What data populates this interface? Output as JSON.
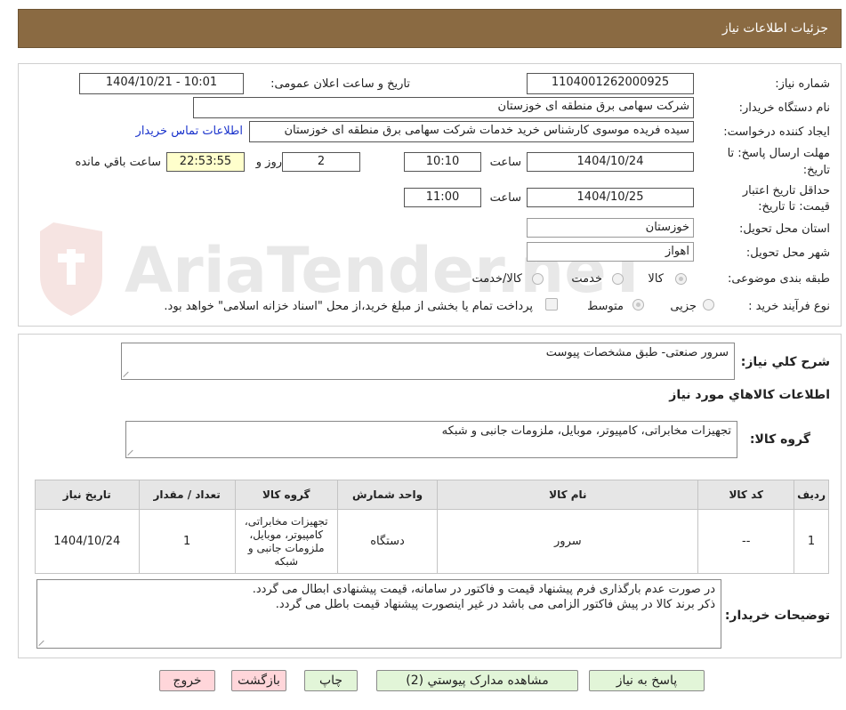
{
  "header": {
    "title": "جزئیات اطلاعات نیاز"
  },
  "watermark": {
    "text": "AriaTender.neT"
  },
  "form": {
    "need_number_label": "شماره نیاز:",
    "need_number": "1104001262000925",
    "announce_label": "تاریخ و ساعت اعلان عمومی:",
    "announce_value": "1404/10/21 - 10:01",
    "buyer_org_label": "نام دستگاه خریدار:",
    "buyer_org": "شرکت سهامی برق منطقه ای خوزستان",
    "creator_label": "ایجاد کننده درخواست:",
    "creator": "سیده فریده موسوی کارشناس خرید خدمات شرکت سهامی برق منطقه ای خوزستان",
    "contact_link": "اطلاعات تماس خریدار",
    "send_deadline_label_1": "مهلت ارسال پاسخ: تا",
    "send_deadline_label_2": "تاریخ:",
    "send_date": "1404/10/24",
    "time_label": "ساعت",
    "send_time": "10:10",
    "days_value": "2",
    "days_label": "روز و",
    "remaining_time": "22:53:55",
    "remaining_label": "ساعت باقي مانده",
    "validity_label_1": "حداقل تاریخ اعتبار",
    "validity_label_2": "قیمت: تا تاریخ:",
    "validity_date": "1404/10/25",
    "validity_time_label": "ساعت",
    "validity_time": "11:00",
    "province_label": "استان محل تحویل:",
    "province": "خوزستان",
    "city_label": "شهر محل تحویل:",
    "city": "اهواز",
    "category_label": "طبقه بندی موضوعی:",
    "category_options": [
      "کالا",
      "خدمت",
      "کالا/خدمت"
    ],
    "category_selected": "کالا",
    "process_label": "نوع فرآیند خرید :",
    "process_options": [
      "جزیی",
      "متوسط"
    ],
    "process_selected": "متوسط",
    "treasury_note": "پرداخت تمام یا بخشی از مبلغ خرید،از محل \"اسناد خزانه اسلامی\" خواهد بود."
  },
  "summary": {
    "desc_label": "شرح کلي نياز:",
    "desc_value": "سرور صنعتی- طبق مشخصات پیوست",
    "goods_info_title": "اطلاعات کالاهاي مورد نياز",
    "group_label": "گروه کالا:",
    "group_value": "تجهیزات مخابراتی، کامپیوتر، موبایل، ملزومات جانبی و شبکه"
  },
  "table": {
    "headers": [
      "رديف",
      "کد کالا",
      "نام کالا",
      "واحد شمارش",
      "گروه کالا",
      "تعداد / مقدار",
      "تاريخ نياز"
    ],
    "rows": [
      {
        "row": "1",
        "code": "--",
        "name": "سرور",
        "unit": "دستگاه",
        "group": "تجهیزات مخابراتی، کامپیوتر، موبایل، ملزومات جانبی و شبکه",
        "qty": "1",
        "date": "1404/10/24"
      }
    ]
  },
  "buyer_notes": {
    "label": "توضیحات خریدار:",
    "line1": "در صورت عدم بارگذاری فرم پیشنهاد قیمت و فاکتور در سامانه، قیمت پیشنهادی ابطال می گردد.",
    "line2": "ذکر برند کالا در پیش فاکتور الزامی می باشد در غیر اینصورت پیشنهاد قیمت باطل می گردد."
  },
  "buttons": {
    "reply": "پاسخ به نیاز",
    "attachments": "مشاهده مدارک پیوستي (2)",
    "print": "چاپ",
    "back": "بازگشت",
    "exit": "خروج"
  },
  "colors": {
    "header_bg": "#8a6a42",
    "link": "#1a33cc",
    "green_button": "#e2f5d8",
    "pink_button": "#ffd6da",
    "remaining_bg": "#ffffcc"
  }
}
